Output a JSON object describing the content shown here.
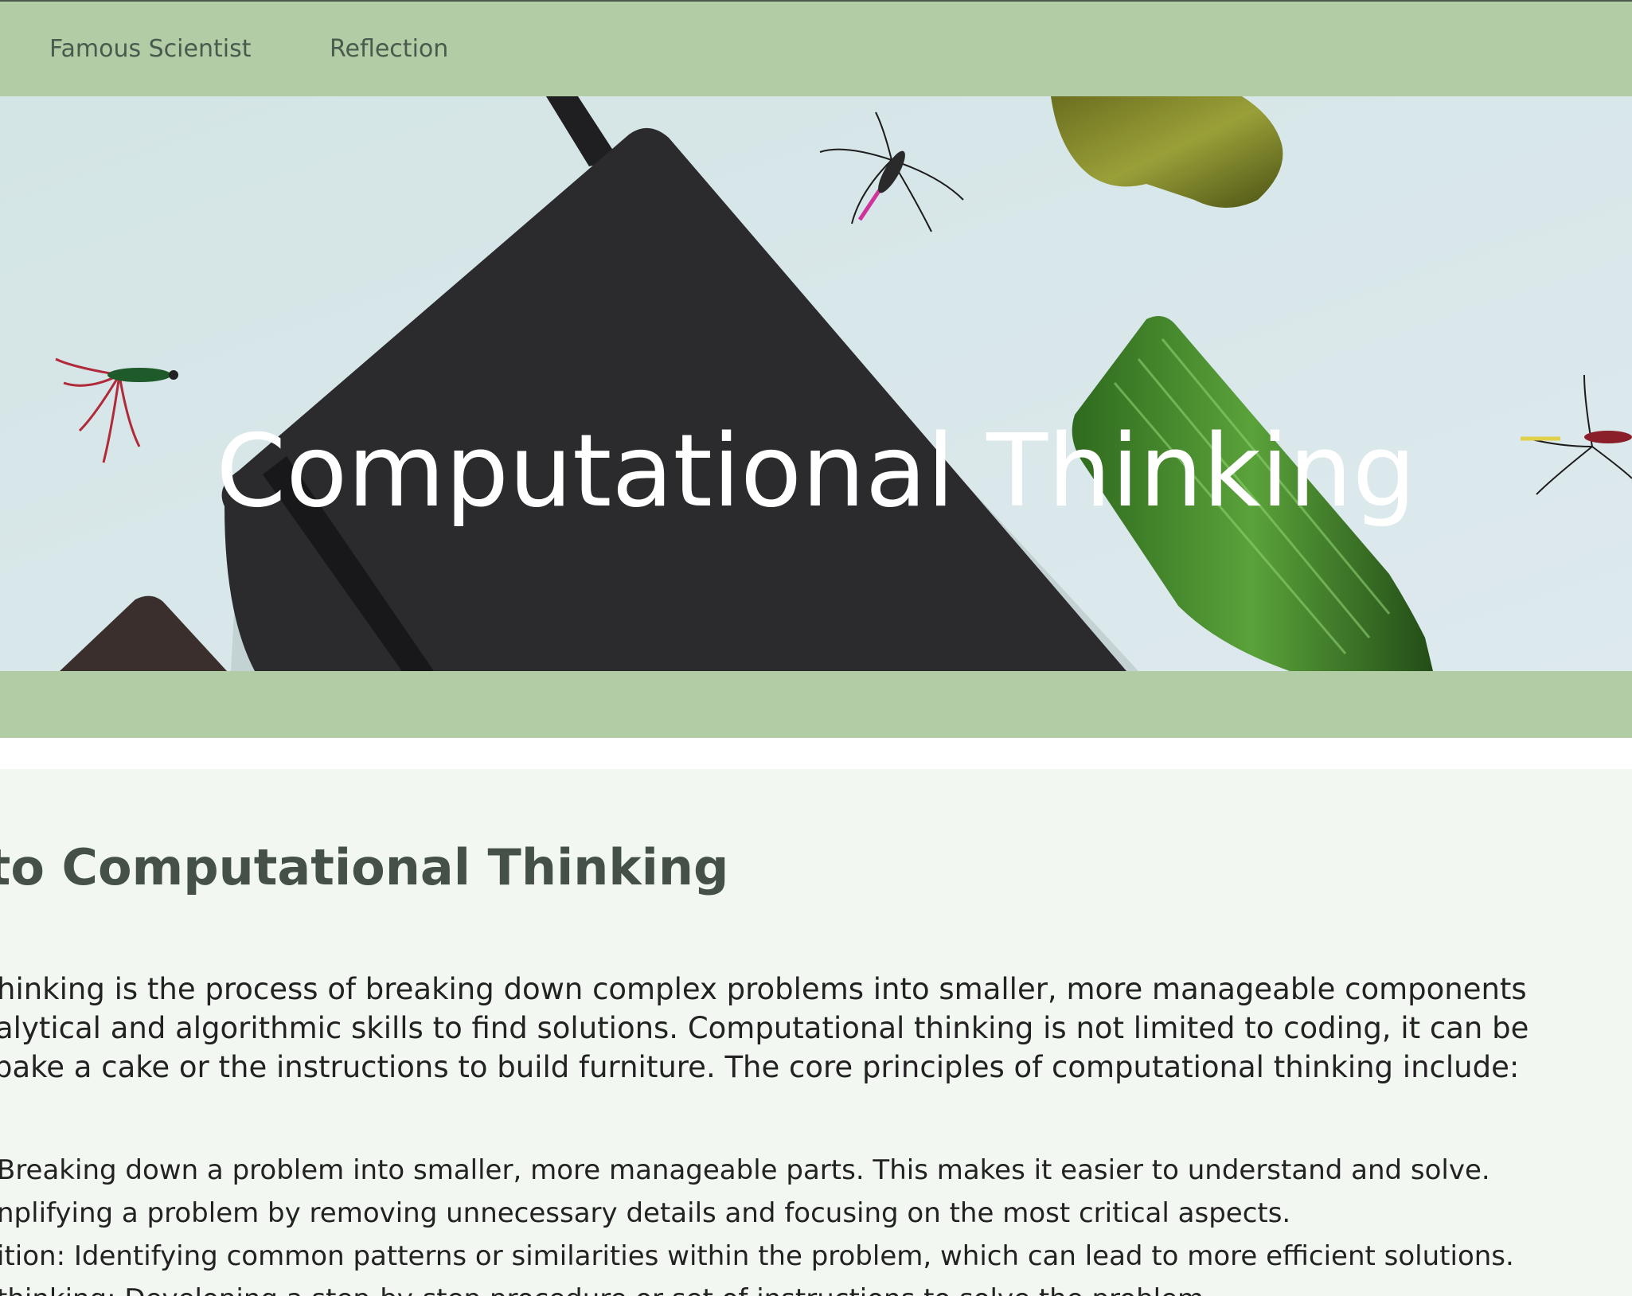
{
  "nav": {
    "links": [
      {
        "label": "Famous Scientist"
      },
      {
        "label": "Reflection"
      }
    ]
  },
  "hero": {
    "title": "Computational Thinking"
  },
  "section": {
    "heading": "n to Computational Thinking",
    "paragraph_lines": [
      "hinking is the process of breaking down complex problems into smaller, more manageable components",
      "alytical and algorithmic skills to find solutions. Computational thinking is not limited to coding, it can be",
      "bake a cake or the instructions to build furniture. The core principles of computational thinking include:"
    ],
    "list_lines": [
      " Breaking down a problem into smaller, more manageable parts. This makes it easier to understand and solve.",
      "nplifying a problem by removing unnecessary details and focusing on the most critical aspects.",
      "ition: Identifying common patterns or similarities within the problem, which can lead to more efficient solutions.",
      "thinking: Developing a step-by-step procedure or set of instructions to solve the problem."
    ]
  },
  "colors": {
    "nav_bg": "#b2cda5",
    "content_bg": "#f2f7f1",
    "heading": "#445048"
  }
}
